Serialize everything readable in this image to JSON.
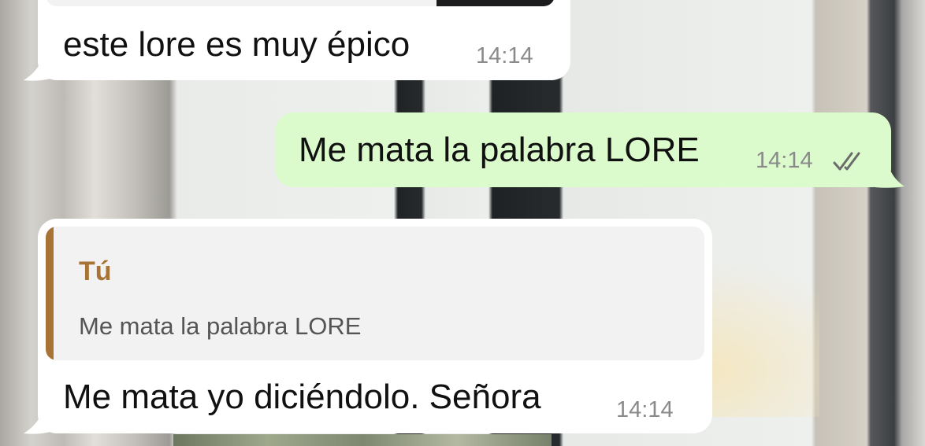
{
  "wallpaper": {
    "description_icon": "wallpaper-image"
  },
  "messages": [
    {
      "direction": "incoming",
      "text": "este lore es muy épico",
      "time": "14:14"
    },
    {
      "direction": "outgoing",
      "text": "Me mata la palabra LORE",
      "time": "14:14",
      "status_icon": "double-check-icon"
    },
    {
      "direction": "incoming",
      "quote": {
        "author": "Tú",
        "text": "Me mata la palabra LORE"
      },
      "text": "Me mata yo diciéndolo. Señora",
      "time": "14:14"
    }
  ],
  "colors": {
    "incoming_bubble": "#ffffff",
    "outgoing_bubble": "#dbfbcd",
    "quote_accent": "#a87436",
    "time_text": "#8a8a8a",
    "read_ticks": "#6b6b6b"
  }
}
